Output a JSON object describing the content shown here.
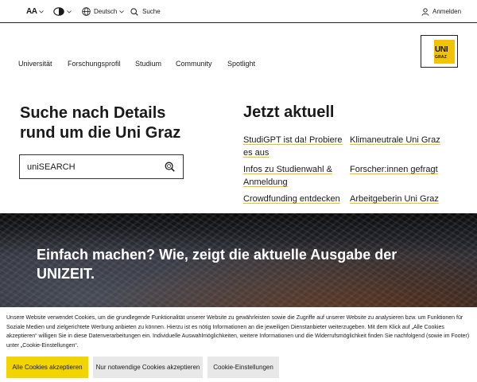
{
  "topbar": {
    "font_size_label": "AA",
    "contrast_icon": "contrast-icon",
    "language": "Deutsch",
    "search": "Suche",
    "login": "Anmelden"
  },
  "logo": {
    "uni": "UNI",
    "graz": "GRAZ",
    "accent_color": "#f2c300"
  },
  "nav": {
    "items": [
      "Universität",
      "Forschungsprofil",
      "Studium",
      "Community",
      "Spotlight"
    ]
  },
  "search_block": {
    "title": "Suche nach Details rund um die Uni Graz",
    "input_label": "uniSEARCH"
  },
  "news": {
    "title": "Jetzt aktuell",
    "links": [
      "StudiGPT ist da! Probiere es aus",
      "Klimaneutrale Uni Graz",
      "Infos zu Studienwahl & Anmeldung",
      "Forscher:innen gefragt",
      "Crowdfunding entdecken",
      "Arbeitgeberin Uni Graz"
    ]
  },
  "hero": {
    "caption": "Einfach machen? Wie, zeigt die aktuelle Ausgabe der UNIZEIT."
  },
  "cookie": {
    "text": "Unsere Website verwendet Cookies, um die grundlegende Funktionalität unserer Website zu gewährleisten sowie die Zugriffe auf unserer Website zu analysieren bzw. um Funktionen für Soziale Medien und zielgerichtete Werbung anbieten zu können. Hierzu ist es nötig Informationen an die jeweiligen Dienstanbieter weiterzugeben. Mit dem Klick auf „Alle Cookies akzeptieren“ willigen Sie in diese Datenverarbeitungen ein. Individuelle Auswahlmöglichkeiten, weitere Informationen und die Widerrufsmöglichkeit finden Sie nachfolgend (sowie im Footer) unter „Cookie-Einstellungen“.",
    "accept_all": "Alle Cookies akzeptieren",
    "accept_necessary": "Nur notwendige Cookies akzeptieren",
    "settings": "Cookie-Einstellungen",
    "accent_color": "#f2d500"
  }
}
